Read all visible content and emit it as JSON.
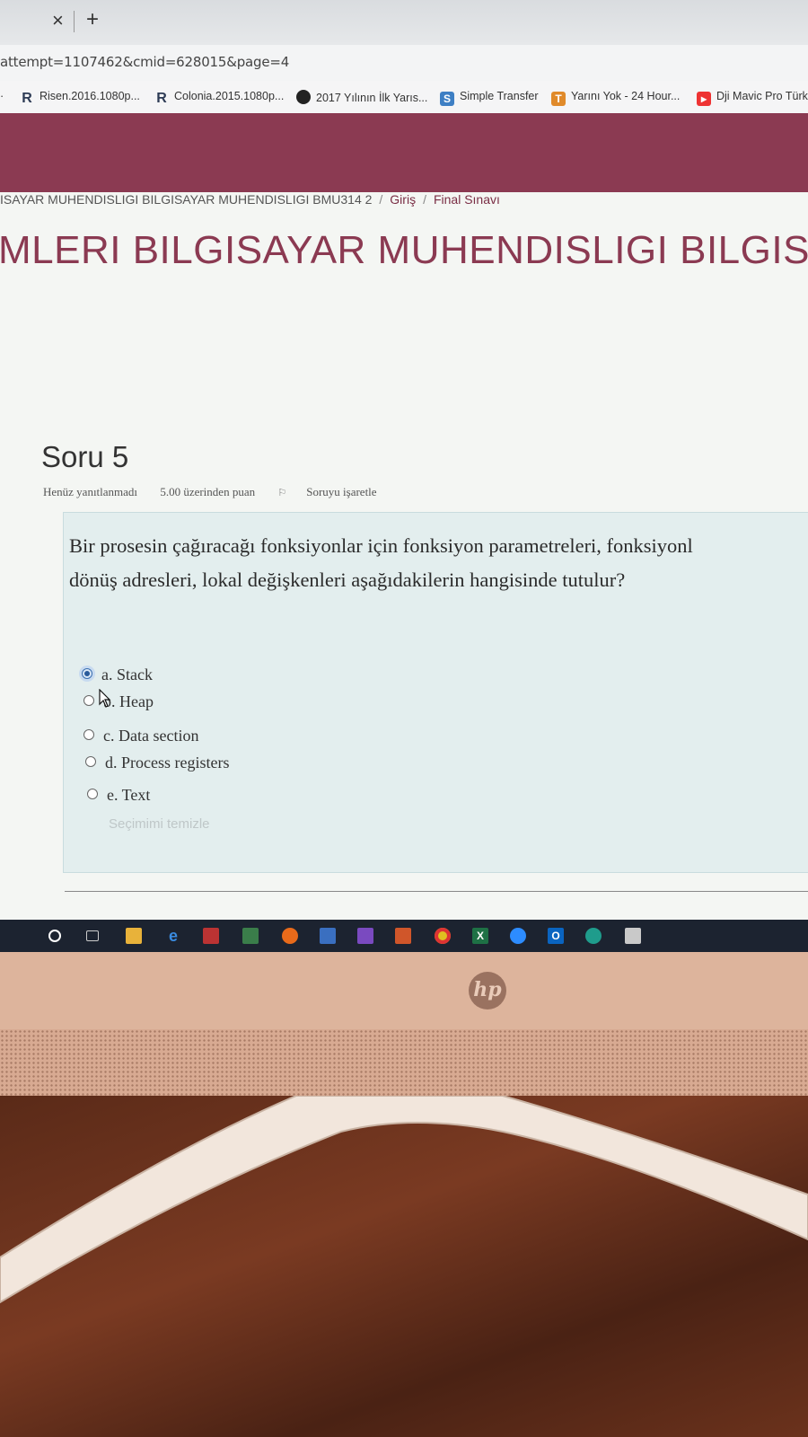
{
  "browser": {
    "tab_close": "×",
    "tab_new": "+",
    "url": "attempt=1107462&cmid=628015&page=4",
    "bookmarks": [
      {
        "label": "Risen.2016.1080p...",
        "icon": "R"
      },
      {
        "label": "Colonia.2015.1080p...",
        "icon": "R"
      },
      {
        "label": "2017 Yılının İlk Yarıs...",
        "icon": "speech-bubble"
      },
      {
        "label": "Simple Transfer",
        "icon": "S"
      },
      {
        "label": "Yarını Yok - 24 Hour...",
        "icon": "T"
      },
      {
        "label": "Dji Mavic Pro Türkç",
        "icon": "youtube"
      }
    ]
  },
  "breadcrumb": {
    "course": "ISAYAR MUHENDISLIGI BILGISAYAR MUHENDISLIGI BMU314 2",
    "item2": "Giriş",
    "item3": "Final Sınavı",
    "separator": "/"
  },
  "page_title": "MLERI BILGISAYAR MUHENDISLIGI BILGISAYA",
  "question": {
    "title": "Soru 5",
    "status": "Henüz yanıtlanmadı",
    "points": "5.00 üzerinden puan",
    "flag": "Soruyu işaretle",
    "text": "Bir prosesin çağıracağı fonksiyonlar için fonksiyon parametreleri, fonksiyonl\ndönüş adresleri, lokal değişkenleri aşağıdakilerin hangisinde tutulur?",
    "options": [
      {
        "label": "a. Stack",
        "checked": true
      },
      {
        "label": "b. Heap",
        "checked": false
      },
      {
        "label": "c. Data section",
        "checked": false
      },
      {
        "label": "d. Process registers",
        "checked": false
      },
      {
        "label": "e. Text",
        "checked": false
      }
    ],
    "clear": "Seçimimi temizle"
  },
  "monitor": {
    "brand": "hp"
  },
  "colors": {
    "accent": "#8b3a52",
    "question_bg": "#e3eeee",
    "taskbar": "#1c2330"
  }
}
